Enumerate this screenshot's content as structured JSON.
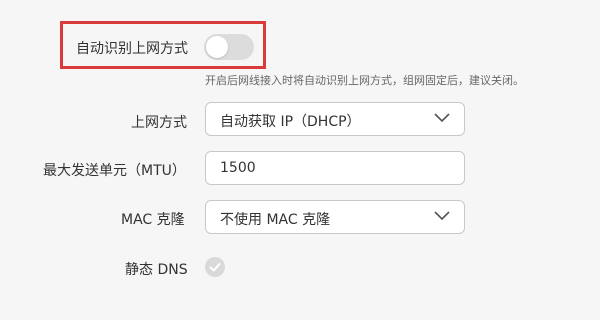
{
  "auto_detect": {
    "label": "自动识别上网方式",
    "toggle_state": "off",
    "hint": "开启后网线接入时将自动识别上网方式，组网固定后，建议关闭。"
  },
  "connection_type": {
    "label": "上网方式",
    "value": "自动获取 IP（DHCP）"
  },
  "mtu": {
    "label": "最大发送单元（MTU）",
    "value": "1500"
  },
  "mac_clone": {
    "label": "MAC 克隆",
    "value": "不使用 MAC 克隆"
  },
  "static_dns": {
    "label": "静态 DNS",
    "checked": false
  },
  "colors": {
    "highlight_border": "#d93a3a",
    "toggle_off": "#dcdcdc",
    "background": "#f6f6f6"
  }
}
